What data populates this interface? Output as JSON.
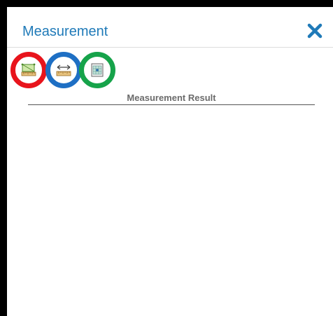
{
  "panel": {
    "title": "Measurement",
    "close_icon": "close-icon",
    "accent_color": "#1f7ab8"
  },
  "tools": [
    {
      "name": "area-tool",
      "icon": "area-measure-icon",
      "highlight_color": "#e8141c"
    },
    {
      "name": "distance-tool",
      "icon": "distance-measure-icon",
      "highlight_color": "#1e6fc4"
    },
    {
      "name": "location-tool",
      "icon": "location-measure-icon",
      "highlight_color": "#16a34a"
    }
  ],
  "result": {
    "label": "Measurement Result"
  }
}
